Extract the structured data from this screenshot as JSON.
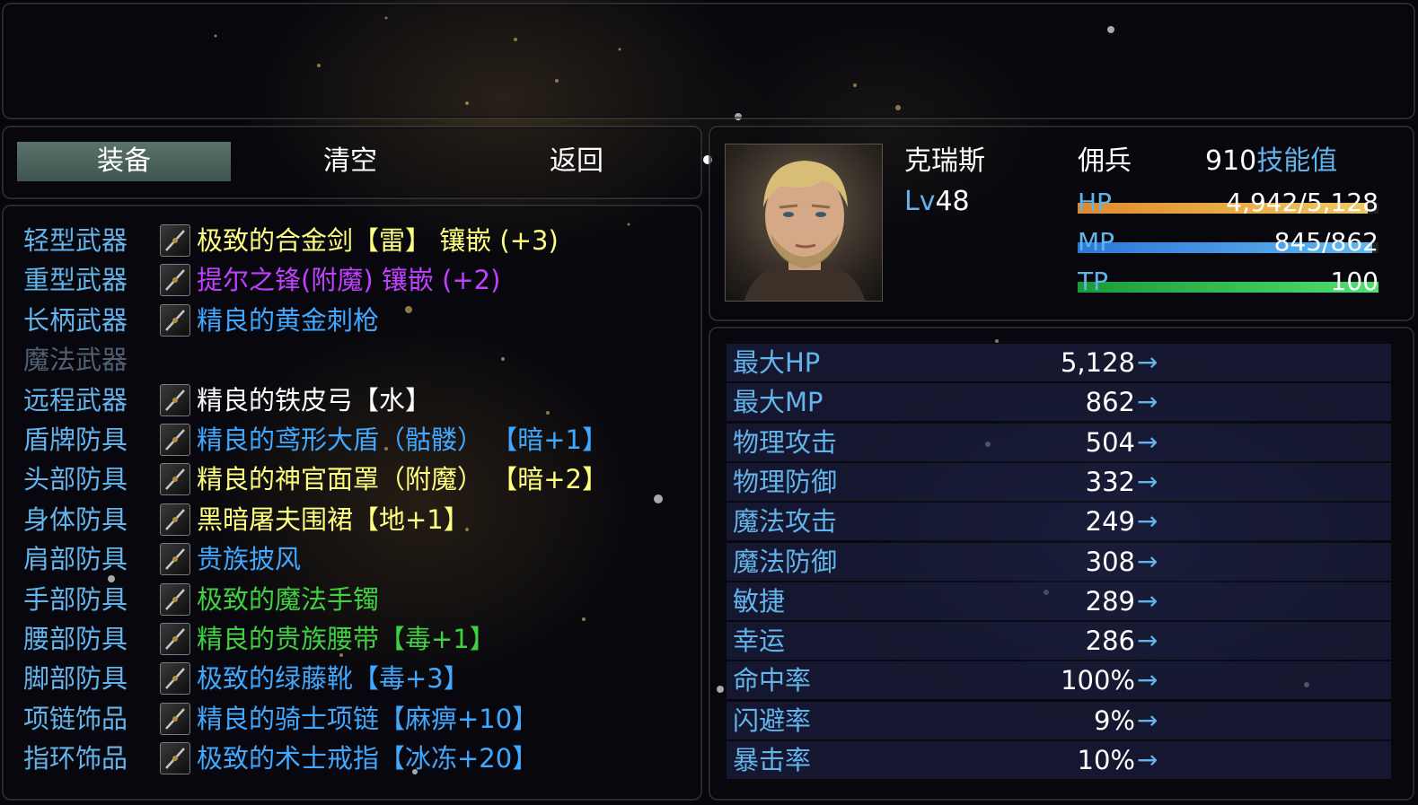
{
  "commands": {
    "equip": "装备",
    "clear": "清空",
    "back": "返回"
  },
  "equipment": [
    {
      "slot": "轻型武器",
      "item": "极致的合金剑【雷】 镶嵌 (+3)",
      "color": "#ffff80",
      "icon": "sword-icon"
    },
    {
      "slot": "重型武器",
      "item": "提尔之锋(附魔) 镶嵌 (+2)",
      "color": "#c040ff",
      "icon": "greatsword-icon"
    },
    {
      "slot": "长柄武器",
      "item": "精良的黄金刺枪",
      "color": "#40a8ff",
      "icon": "spear-icon"
    },
    {
      "slot": "魔法武器",
      "item": "",
      "color": "#ffffff",
      "icon": ""
    },
    {
      "slot": "远程武器",
      "item": "精良的铁皮弓【水】",
      "color": "#ffffff",
      "icon": "bow-icon"
    },
    {
      "slot": "盾牌防具",
      "item": "精良的鸢形大盾（骷髅） 【暗+1】",
      "color": "#40a8ff",
      "icon": "shield-icon"
    },
    {
      "slot": "头部防具",
      "item": "精良的神官面罩（附魔） 【暗+2】",
      "color": "#ffff80",
      "icon": "helmet-icon"
    },
    {
      "slot": "身体防具",
      "item": "黑暗屠夫围裙【地+1】",
      "color": "#ffff80",
      "icon": "armor-icon"
    },
    {
      "slot": "肩部防具",
      "item": "贵族披风",
      "color": "#40a8ff",
      "icon": "cloak-icon"
    },
    {
      "slot": "手部防具",
      "item": "极致的魔法手镯",
      "color": "#40d040",
      "icon": "bracelet-icon"
    },
    {
      "slot": "腰部防具",
      "item": "精良的贵族腰带【毒+1】",
      "color": "#40d040",
      "icon": "belt-icon"
    },
    {
      "slot": "脚部防具",
      "item": "极致的绿藤靴【毒+3】",
      "color": "#40a8ff",
      "icon": "boots-icon"
    },
    {
      "slot": "项链饰品",
      "item": "精良的骑士项链【麻痹+10】",
      "color": "#40a8ff",
      "icon": "necklace-icon"
    },
    {
      "slot": "指环饰品",
      "item": "极致的术士戒指【冰冻+20】",
      "color": "#40a8ff",
      "icon": "ring-icon"
    }
  ],
  "actor": {
    "name": "克瑞斯",
    "class": "佣兵",
    "level_label": "Lv",
    "level": "48",
    "skill_points": "910",
    "skill_points_label": "技能值",
    "hp_label": "HP",
    "hp_text": "4,942/5,128",
    "hp_ratio": 0.964,
    "mp_label": "MP",
    "mp_text": "845/862",
    "mp_ratio": 0.98,
    "tp_label": "TP",
    "tp_text": "100",
    "tp_ratio": 1.0,
    "hp_colors": [
      "#e08a2c",
      "#f0c860"
    ],
    "mp_colors": [
      "#2a78d8",
      "#60b8f0"
    ],
    "tp_colors": [
      "#1a9a3a",
      "#50e070"
    ],
    "portrait": "mercenary-portrait"
  },
  "stats": [
    {
      "label": "最大HP",
      "value": "5,128"
    },
    {
      "label": "最大MP",
      "value": "862"
    },
    {
      "label": "物理攻击",
      "value": "504"
    },
    {
      "label": "物理防御",
      "value": "332"
    },
    {
      "label": "魔法攻击",
      "value": "249"
    },
    {
      "label": "魔法防御",
      "value": "308"
    },
    {
      "label": "敏捷",
      "value": "289"
    },
    {
      "label": "幸运",
      "value": "286"
    },
    {
      "label": "命中率",
      "value": "100%"
    },
    {
      "label": "闪避率",
      "value": "9%"
    },
    {
      "label": "暴击率",
      "value": "10%"
    }
  ],
  "arrow": "→",
  "colors": {
    "system": "#62b4ea",
    "normal": "#ffffff"
  }
}
